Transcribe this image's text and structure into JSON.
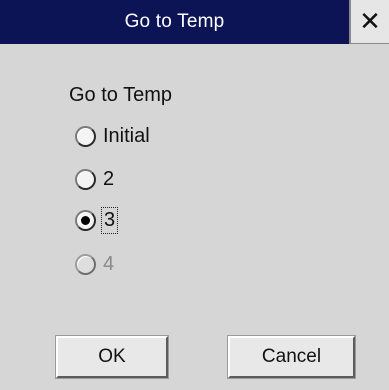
{
  "window": {
    "title": "Go to Temp",
    "close_glyph": "✕"
  },
  "group": {
    "label": "Go to Temp",
    "options": [
      {
        "label": "Initial",
        "selected": false,
        "enabled": true
      },
      {
        "label": "2",
        "selected": false,
        "enabled": true
      },
      {
        "label": "3",
        "selected": true,
        "enabled": true,
        "focused": true
      },
      {
        "label": "4",
        "selected": false,
        "enabled": false
      }
    ]
  },
  "buttons": {
    "ok_label": "OK",
    "cancel_label": "Cancel"
  },
  "colors": {
    "titlebar": "#0c1455",
    "dialog_bg": "#d6d6d6",
    "disabled_text": "#8a8a8a"
  }
}
